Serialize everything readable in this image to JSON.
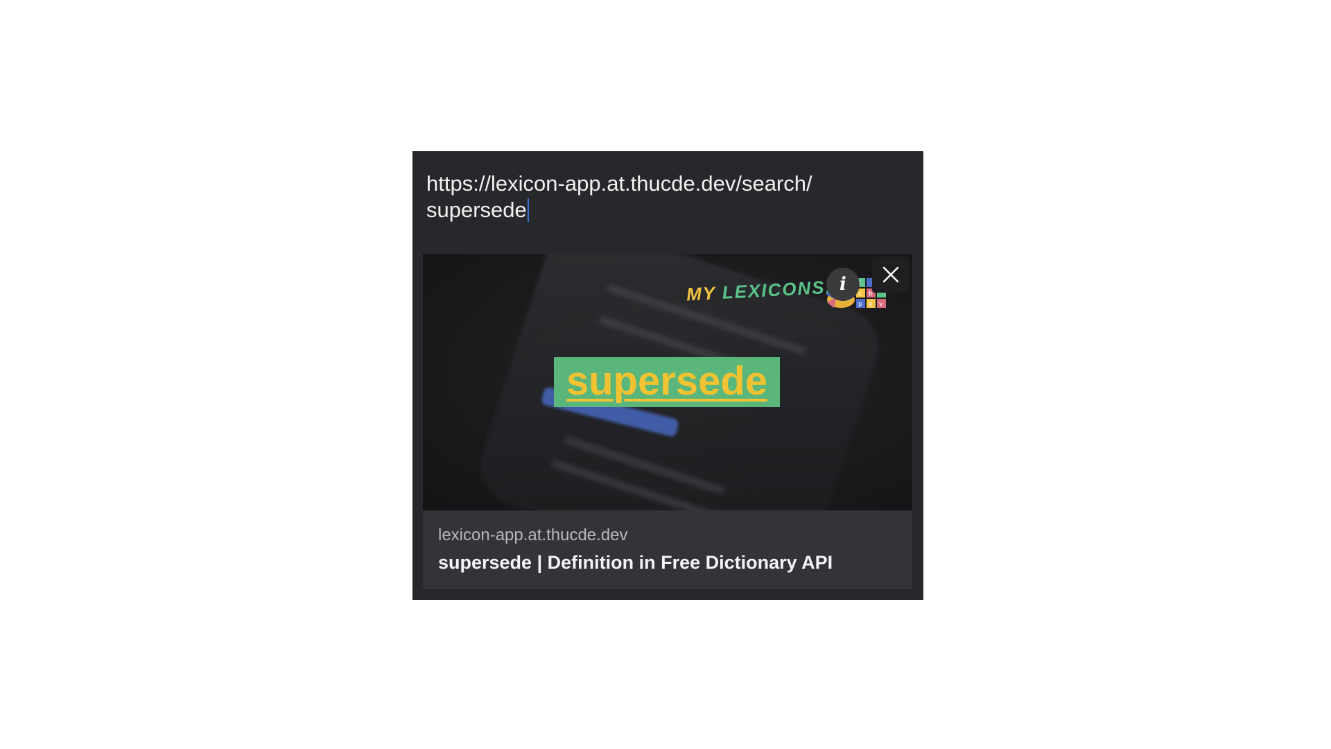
{
  "url_field": {
    "line1": "https://lexicon-app.at.thucde.dev/search/",
    "line2": "supersede"
  },
  "link_preview": {
    "image": {
      "headline_word": "supersede",
      "logo_text_my": "MY",
      "logo_text_lexicons": "LEXICONS!",
      "logo_grid_letters": [
        "l",
        "",
        "c",
        "b",
        "p",
        "e",
        "v"
      ]
    },
    "info_icon_glyph": "i",
    "close_icon": "close-icon",
    "domain": "lexicon-app.at.thucde.dev",
    "title": "supersede | Definition in Free Dictionary API"
  },
  "colors": {
    "card_background": "#27282b",
    "caption_background": "#333438",
    "headline_box": "#5bb67b",
    "headline_text": "#f1c232",
    "logo_yellow": "#f4c542",
    "logo_green": "#5bc48a",
    "caret": "#3f6fd6"
  }
}
